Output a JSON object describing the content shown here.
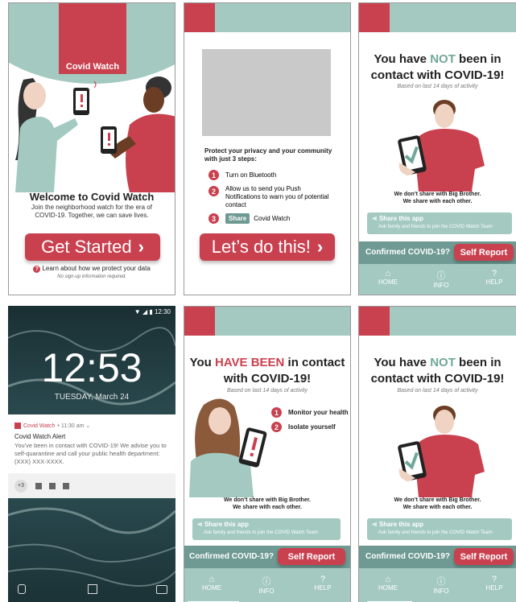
{
  "screen1": {
    "banner_title": "Covid Watch",
    "welcome_title": "Welcome to Covid Watch",
    "welcome_sub": "Join the neighborhood watch for the era of COVID-19. Together, we can save lives.",
    "cta": "Get Started",
    "privacy_link": "Learn about how we protect your data",
    "no_signup": "No sign-up information required."
  },
  "screen2": {
    "intro": "Protect your privacy and your community with just 3 steps:",
    "steps": [
      {
        "num": "1",
        "text": "Turn on Bluetooth"
      },
      {
        "num": "2",
        "text": "Allow us to send you Push Notifications to warn you of potential contact"
      },
      {
        "num": "3",
        "share_label": "Share",
        "text": "Covid Watch"
      }
    ],
    "cta": "Let’s do this!"
  },
  "status_not": {
    "line1_pre": "You have ",
    "line1_em": "NOT",
    "line1_post": " been in",
    "line2": "contact with COVID-19!",
    "based": "Based on last 14 days of activity",
    "caption1": "We don’t share with Big Brother.",
    "caption2": "We share with each other.",
    "share_title": "Share this app",
    "share_sub": "Ask family and friends to join the COVID Watch Team",
    "confirmed": "Confirmed COVID-19?",
    "self_report": "Self Report",
    "nav": [
      "HOME",
      "INFO",
      "HELP"
    ]
  },
  "status_has": {
    "line1_pre": "You ",
    "line1_em": "HAVE BEEN",
    "line1_post": " in contact",
    "line2": "with COVID-19!",
    "based": "Based on last 14 days of activity",
    "actions": [
      {
        "num": "1",
        "text": "Monitor your health"
      },
      {
        "num": "2",
        "text": "Isolate yourself"
      }
    ],
    "caption1": "We don’t share with Big Brother.",
    "caption2": "We share with each other."
  },
  "lock": {
    "status_time": "12:30",
    "clock": "12:53",
    "date": "TUESDAY, March 24",
    "notif_app": "Covid Watch",
    "notif_time": "• 11:30 am ⌄",
    "notif_title": "Covid Watch Alert",
    "notif_body": "You've been in contact with COVID-19! We advise you to self-quarantine and call your public health department: (XXX) XXX-XXXX.",
    "more_count": "+3"
  },
  "colors": {
    "red": "#c9414f",
    "teal": "#a3c9c1",
    "dark_teal": "#6f9a93",
    "green_text": "#6fa89a"
  }
}
